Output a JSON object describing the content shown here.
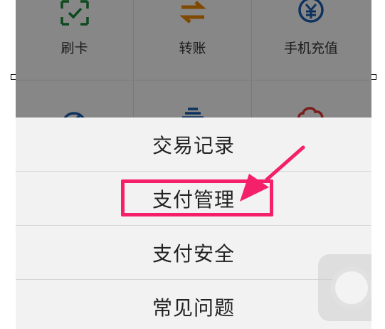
{
  "grid": {
    "items": [
      {
        "label": "刷卡",
        "icon": "card-scan-icon",
        "color": "#1a8a3a"
      },
      {
        "label": "转账",
        "icon": "transfer-icon",
        "color": "#f08a00"
      },
      {
        "label": "手机充值",
        "icon": "mobile-topup-yen-icon",
        "color": "#1a5fb4"
      },
      {
        "label": "",
        "icon": "check-circle-icon",
        "color": "#1a5fb4"
      },
      {
        "label": "",
        "icon": "basket-icon",
        "color": "#1a5fb4"
      },
      {
        "label": "",
        "icon": "cloud-icon",
        "color": "#e53935"
      }
    ]
  },
  "menu": {
    "items": [
      {
        "label": "交易记录"
      },
      {
        "label": "支付管理"
      },
      {
        "label": "支付安全"
      },
      {
        "label": "常见问题"
      }
    ]
  },
  "annotation": {
    "color": "#f5206a"
  }
}
